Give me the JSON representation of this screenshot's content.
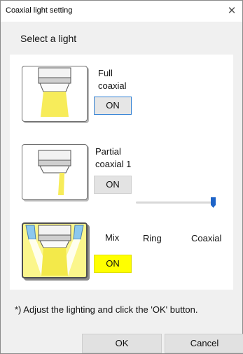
{
  "window": {
    "title": "Coaxial light setting",
    "close_glyph": "✕"
  },
  "heading": "Select a light",
  "lights": [
    {
      "label_line1": "Full",
      "label_line2": "coaxial",
      "button": "ON",
      "state": "focused"
    },
    {
      "label_line1": "Partial",
      "label_line2": "coaxial 1",
      "button": "ON",
      "state": "normal"
    },
    {
      "label_line1": "Mix",
      "button": "ON",
      "state": "selected"
    }
  ],
  "mix_slider": {
    "left_label": "Ring",
    "right_label": "Coaxial",
    "value_fraction": 1.0
  },
  "note": "*) Adjust the lighting and click the 'OK' button.",
  "buttons": {
    "ok": "OK",
    "cancel": "Cancel"
  },
  "colors": {
    "highlight": "#ffff00",
    "lamp_yellow": "#f7ec5a",
    "accent_blue": "#1e64c8"
  }
}
